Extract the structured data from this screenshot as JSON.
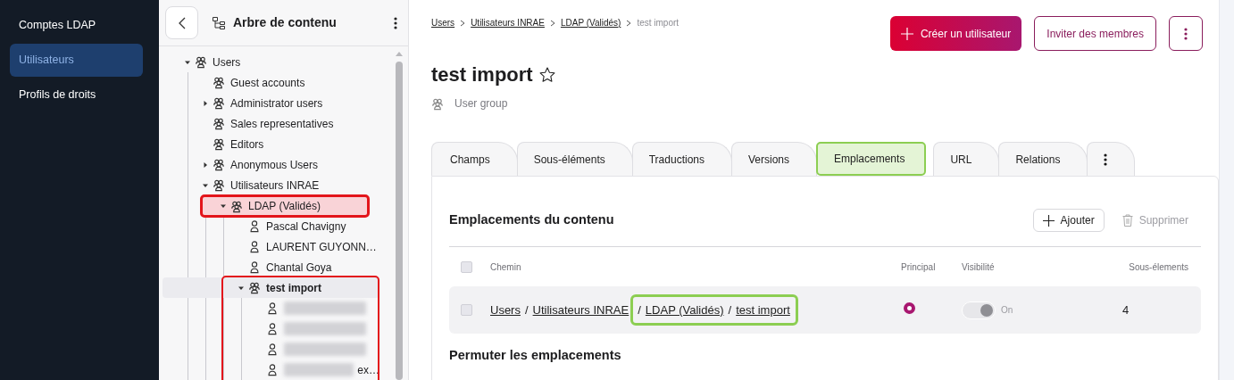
{
  "sidebar": {
    "items": [
      {
        "label": "Comptes LDAP",
        "selected": false
      },
      {
        "label": "Utilisateurs",
        "selected": true
      },
      {
        "label": "Profils de droits",
        "selected": false
      }
    ]
  },
  "tree_panel": {
    "title": "Arbre de contenu",
    "nodes": [
      {
        "label": "Users",
        "kind": "group",
        "expanded": true,
        "selected": false,
        "children": [
          {
            "label": "Guest accounts",
            "kind": "group",
            "selected": false
          },
          {
            "label": "Administrator users",
            "kind": "group",
            "expanded": false,
            "selected": false
          },
          {
            "label": "Sales representatives",
            "kind": "group",
            "selected": false
          },
          {
            "label": "Editors",
            "kind": "group",
            "selected": false
          },
          {
            "label": "Anonymous Users",
            "kind": "group",
            "expanded": false,
            "selected": false
          },
          {
            "label": "Utilisateurs INRAE",
            "kind": "group",
            "expanded": true,
            "selected": false,
            "children": [
              {
                "label": "LDAP (Validés)",
                "kind": "group",
                "expanded": true,
                "selected": false,
                "annotated": true,
                "children": [
                  {
                    "label": "Pascal Chavigny",
                    "kind": "user",
                    "selected": false
                  },
                  {
                    "label": "LAURENT GUYONN…",
                    "kind": "user",
                    "selected": false
                  },
                  {
                    "label": "Chantal Goya",
                    "kind": "user",
                    "selected": false
                  },
                  {
                    "label": "test import",
                    "kind": "group",
                    "expanded": true,
                    "selected": true,
                    "framed": true,
                    "children": [
                      {
                        "kind": "user",
                        "redacted": true,
                        "selected": false
                      },
                      {
                        "kind": "user",
                        "redacted": true,
                        "selected": false
                      },
                      {
                        "kind": "user",
                        "redacted": true,
                        "selected": false
                      },
                      {
                        "label": "ex…",
                        "kind": "user",
                        "redacted": true,
                        "selected": false
                      }
                    ]
                  }
                ]
              }
            ]
          }
        ]
      }
    ]
  },
  "breadcrumb": [
    {
      "label": "Users",
      "link": true
    },
    {
      "label": "Utilisateurs INRAE",
      "link": true
    },
    {
      "label": "LDAP (Validés)",
      "link": true
    },
    {
      "label": "test import",
      "link": false
    }
  ],
  "header_buttons": [
    {
      "kind": "primary",
      "label": "Créer un utilisateur"
    },
    {
      "kind": "outline",
      "label": "Inviter des membres"
    },
    {
      "kind": "more"
    }
  ],
  "title": "test import",
  "favorite": false,
  "subtitle": "User group",
  "tabs": [
    {
      "label": "Champs",
      "selected": false,
      "annotated": false
    },
    {
      "label": "Sous-éléments",
      "selected": false,
      "annotated": false
    },
    {
      "label": "Traductions",
      "selected": false,
      "annotated": false
    },
    {
      "label": "Versions",
      "selected": false,
      "annotated": false
    },
    {
      "label": "Emplacements",
      "selected": true,
      "annotated": true
    },
    {
      "label": "URL",
      "selected": false,
      "annotated": false
    },
    {
      "label": "Relations",
      "selected": false,
      "annotated": false
    },
    {
      "kind": "more",
      "selected": false,
      "annotated": false
    }
  ],
  "locations": {
    "title": "Emplacements du contenu",
    "actions": [
      {
        "kind": "add",
        "label": "Ajouter",
        "disabled": false
      },
      {
        "kind": "delete",
        "label": "Supprimer",
        "disabled": true
      }
    ],
    "select_all_checked": false,
    "columns": [
      "Chemin",
      "Principal",
      "Visibilité",
      "Sous-élements"
    ],
    "rows": [
      {
        "checked": false,
        "path": [
          {
            "label": "Users",
            "annotated": false
          },
          {
            "separator": "/",
            "label": "Utilisateurs INRAE",
            "annotated": false
          },
          {
            "separator": "/",
            "label": "LDAP (Validés)",
            "annotated": true
          },
          {
            "separator": "/",
            "label": "test import",
            "annotated": true
          }
        ],
        "principal": true,
        "visible": true,
        "visibility_disabled": true,
        "visibility_label": "On",
        "children_count": "4"
      }
    ]
  },
  "next_section": "Permuter les emplacements"
}
